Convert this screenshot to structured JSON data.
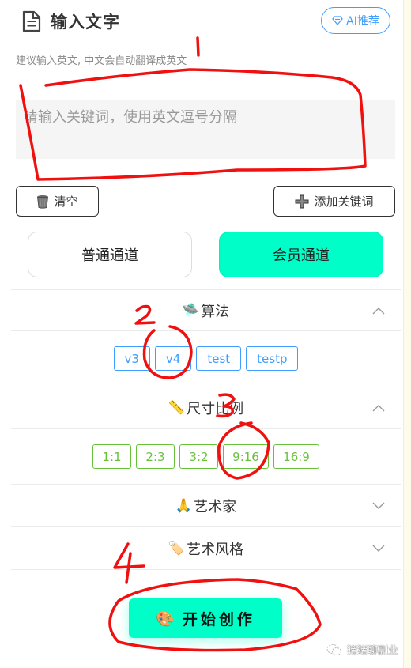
{
  "header": {
    "title": "输入文字",
    "title_icon": "document-icon",
    "ai_button": {
      "label": "AI推荐",
      "icon": "diamond-icon"
    }
  },
  "hint": "建议输入英文, 中文会自动翻译成英文",
  "keyword_input": {
    "value": "",
    "placeholder": "请输入关键词，使用英文逗号分隔"
  },
  "actions": {
    "clear": {
      "label": "清空",
      "icon": "wastebasket-icon"
    },
    "add_keyword": {
      "label": "添加关键词",
      "icon": "plus-icon"
    }
  },
  "channels": [
    {
      "label": "普通通道",
      "selected": false
    },
    {
      "label": "会员通道",
      "selected": true
    }
  ],
  "sections": [
    {
      "emoji": "🛸",
      "icon": "ufo-icon",
      "label": "算法",
      "expanded": true,
      "options": [
        "v3",
        "v4",
        "test",
        "testp"
      ]
    },
    {
      "emoji": "📏",
      "icon": "ruler-icon",
      "label": "尺寸比例",
      "expanded": true,
      "options": [
        "1:1",
        "2:3",
        "3:2",
        "9:16",
        "16:9"
      ]
    },
    {
      "emoji": "🙏",
      "icon": "folded-hands-icon",
      "label": "艺术家",
      "expanded": false
    },
    {
      "emoji": "🏷️",
      "icon": "label-tag-icon",
      "label": "艺术风格",
      "expanded": false
    }
  ],
  "start_button": {
    "emoji": "🎨",
    "icon": "palette-icon",
    "label": "开始创作"
  },
  "watermark": "猪猪聊副业",
  "annotations": [
    "1",
    "2",
    "3",
    "4"
  ],
  "colors": {
    "accent": "#00ffc8",
    "blue": "#409eff",
    "green": "#67c23a",
    "annotation_red": "#f01010"
  }
}
